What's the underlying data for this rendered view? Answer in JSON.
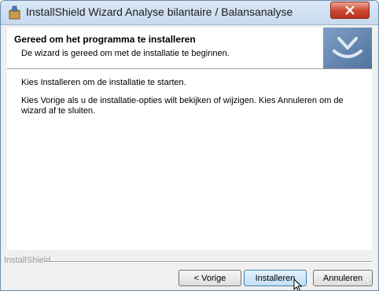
{
  "window": {
    "title": "InstallShield Wizard Analyse bilantaire / Balansanalyse",
    "icons": {
      "app": "installer-box-icon",
      "close": "close-icon",
      "logo": "installshield-logo-icon"
    }
  },
  "banner": {
    "title": "Gereed om het programma te installeren",
    "subtitle": "De wizard is gereed om met de installatie te beginnen."
  },
  "content": {
    "paragraph1": "Kies Installeren om de installatie te starten.",
    "paragraph2": "Kies Vorige als u de installatie-opties wilt bekijken of wijzigen. Kies Annuleren om de wizard af te sluiten."
  },
  "footer": {
    "brand": "InstallShield",
    "buttons": {
      "back": "< Vorige",
      "install": "Installeren",
      "cancel": "Annuleren"
    }
  },
  "colors": {
    "title_bar": "#c6d9ee",
    "close_button": "#c8452f",
    "default_button_border": "#3c7fb1"
  }
}
